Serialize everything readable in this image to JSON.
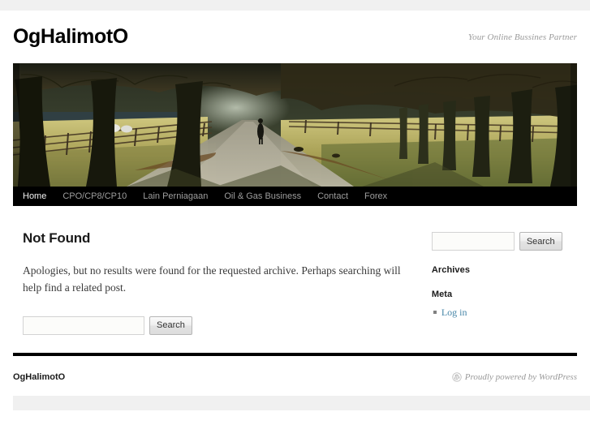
{
  "site": {
    "title": "OgHalimotO",
    "description": "Your Online Bussines Partner"
  },
  "nav": {
    "items": [
      {
        "label": "Home",
        "active": true
      },
      {
        "label": "CPO/CP8/CP10",
        "active": false
      },
      {
        "label": "Lain Perniagaan",
        "active": false
      },
      {
        "label": "Oil & Gas Business",
        "active": false
      },
      {
        "label": "Contact",
        "active": false
      },
      {
        "label": "Forex",
        "active": false
      }
    ]
  },
  "header_image": {
    "alt": "tree-lined-avenue-header-image"
  },
  "content": {
    "title": "Not Found",
    "body": "Apologies, but no results were found for the requested archive. Perhaps searching will help find a related post.",
    "search": {
      "value": "",
      "placeholder": "",
      "button_label": "Search"
    }
  },
  "sidebar": {
    "search": {
      "value": "",
      "placeholder": "",
      "button_label": "Search"
    },
    "widgets": [
      {
        "title": "Archives",
        "items": []
      },
      {
        "title": "Meta",
        "items": [
          {
            "label": "Log in"
          }
        ]
      }
    ]
  },
  "footer": {
    "title": "OgHalimotO",
    "credit": "Proudly powered by WordPress"
  },
  "colors": {
    "link": "#4786a8",
    "nav_bg": "#000000",
    "nav_text": "#9e9e9e",
    "nav_active": "#f2f2f2",
    "muted": "#9a9a9a",
    "gutter": "#f0f0f0"
  }
}
